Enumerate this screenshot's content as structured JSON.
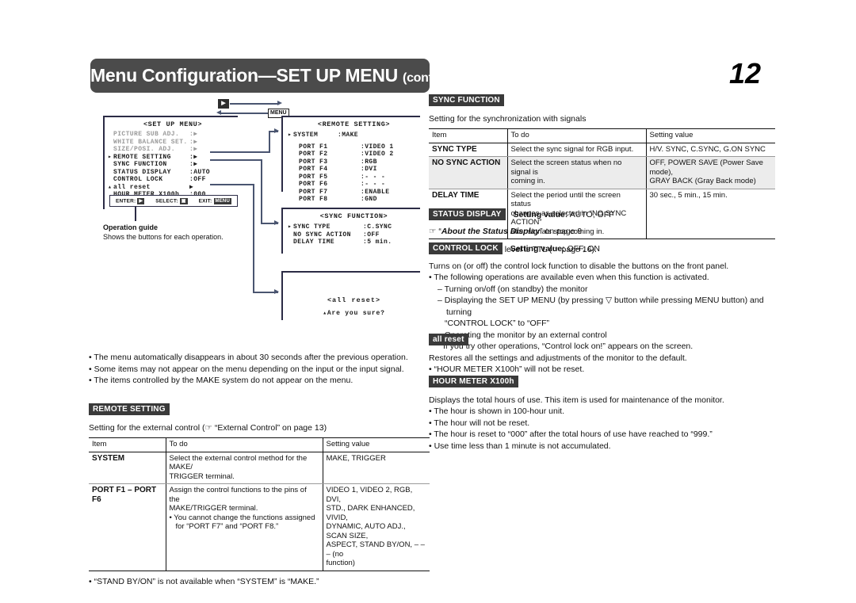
{
  "header": {
    "title_main": "Menu Configuration—SET UP MENU",
    "title_cont": "(cont.)",
    "page_number": "12"
  },
  "diagram": {
    "buttons": {
      "enter_chip": "▶",
      "menu_chip": "MENU"
    },
    "setup_menu": {
      "title": "<SET UP MENU>",
      "rows": [
        {
          "cursor": "",
          "key": "PICTURE SUB ADJ.",
          "value": ":▶",
          "dim": true
        },
        {
          "cursor": "",
          "key": "WHITE BALANCE SET.",
          "value": ":▶",
          "dim": true
        },
        {
          "cursor": "",
          "key": "SIZE/POSI. ADJ.",
          "value": ":▶",
          "dim": true
        },
        {
          "cursor": "▸",
          "key": "REMOTE SETTING",
          "value": ":▶",
          "dim": false
        },
        {
          "cursor": "",
          "key": "SYNC FUNCTION",
          "value": ":▶",
          "dim": false
        },
        {
          "cursor": "",
          "key": "STATUS DISPLAY",
          "value": ":AUTO",
          "dim": false
        },
        {
          "cursor": "",
          "key": "CONTROL LOCK",
          "value": ":OFF",
          "dim": false
        },
        {
          "cursor": "▴",
          "key": "all reset",
          "value": "▶",
          "dim": false
        },
        {
          "cursor": "",
          "key": "HOUR METER X100h",
          "value": ":000",
          "dim": false
        }
      ],
      "guide": {
        "enter_label": "ENTER:",
        "enter_key": "▶",
        "select_label": "SELECT:",
        "select_key": "▣",
        "exit_label": "EXIT:",
        "exit_key": "MENU"
      }
    },
    "operation_guide": {
      "title": "Operation guide",
      "text": "Shows the buttons for each operation."
    },
    "remote_setting": {
      "title": "<REMOTE SETTING>",
      "system_row": {
        "cursor": "▸",
        "key": "SYSTEM",
        "value": ":MAKE"
      },
      "ports": [
        {
          "key": "PORT F1",
          "value": ":VIDEO 1"
        },
        {
          "key": "PORT F2",
          "value": ":VIDEO 2"
        },
        {
          "key": "PORT F3",
          "value": ":RGB"
        },
        {
          "key": "PORT F4",
          "value": ":DVI"
        },
        {
          "key": "PORT F5",
          "value": ":- - -"
        },
        {
          "key": "PORT F6",
          "value": ":- - -"
        },
        {
          "key": "PORT F7",
          "value": ":ENABLE"
        },
        {
          "key": "PORT F8",
          "value": ":GND"
        }
      ]
    },
    "sync_function": {
      "title": "<SYNC FUNCTION>",
      "rows": [
        {
          "cursor": "▸",
          "key": "SYNC TYPE",
          "value": ":C.SYNC"
        },
        {
          "cursor": "",
          "key": "NO SYNC ACTION",
          "value": ":OFF"
        },
        {
          "cursor": "",
          "key": "DELAY TIME",
          "value": ":5 min."
        }
      ]
    },
    "all_reset": {
      "title": "<all reset>",
      "question": "▴Are you sure?"
    }
  },
  "left_column": {
    "notes": [
      "The menu automatically disappears in about 30 seconds after the previous operation.",
      "Some items may not appear on the menu depending on the input or the input signal.",
      "The items controlled by the MAKE system do not appear on the menu."
    ],
    "remote_setting_section": {
      "tag": "REMOTE SETTING",
      "intro": "Setting for the external control (☞ “External Control” on page 13)",
      "table": {
        "headers": [
          "Item",
          "To do",
          "Setting value"
        ],
        "rows": [
          {
            "item": "SYSTEM",
            "todo_lines": [
              "Select the external control method for the MAKE/",
              "TRIGGER terminal."
            ],
            "todo_bullets": [],
            "value_lines": [
              "MAKE, TRIGGER"
            ]
          },
          {
            "item": "PORT F1 – PORT F6",
            "todo_lines": [
              "Assign the control functions to the pins of the",
              "MAKE/TRIGGER terminal."
            ],
            "todo_bullets": [
              "You cannot change the functions assigned for “PORT F7” and “PORT F8.”"
            ],
            "value_lines": [
              "VIDEO 1, VIDEO 2, RGB, DVI,",
              "STD., DARK ENHANCED, VIVID,",
              "DYNAMIC, AUTO ADJ., SCAN SIZE,",
              "ASPECT, STAND BY/ON, – – – (no",
              "function)"
            ]
          }
        ]
      },
      "footnote": "“STAND BY/ON” is not available when “SYSTEM” is “MAKE.”"
    }
  },
  "right_column": {
    "sync_function_section": {
      "tag": "SYNC FUNCTION",
      "intro": "Setting for the synchronization with signals",
      "table": {
        "headers": [
          "Item",
          "To do",
          "Setting value"
        ],
        "rows": [
          {
            "item": "SYNC TYPE",
            "todo_lines": [
              "Select the sync signal for RGB input."
            ],
            "value_lines": [
              "H/V. SYNC, C.SYNC, G.ON SYNC"
            ]
          },
          {
            "item": "NO SYNC ACTION",
            "todo_lines": [
              "Select the screen status when no signal is",
              "coming in."
            ],
            "value_lines": [
              "OFF, POWER SAVE (Power Save mode),",
              "GRAY BACK (Gray Back mode)"
            ]
          },
          {
            "item": "DELAY TIME",
            "todo_lines": [
              "Select the period until the screen status",
              "changes as selected in “NO SYNC ACTION”",
              "after signals stop coming in."
            ],
            "value_lines": [
              "30 sec., 5 min., 15 min."
            ]
          }
        ]
      },
      "footnote": "The C.SYNC input level is TTL (☞ page 16)."
    },
    "status_display_section": {
      "tag": "STATUS DISPLAY",
      "setting_label": "Setting value:",
      "setting_value": "AUTO, OFF",
      "ref_prefix": "☞ “",
      "ref_italic": "About the Status Display",
      "ref_suffix": "” on page 9"
    },
    "control_lock_section": {
      "tag": "CONTROL LOCK",
      "setting_label": "Setting value:",
      "setting_value": "OFF, ON",
      "body": "Turns on (or off) the control lock function to disable the buttons on the front panel.",
      "bullet": "The following operations are available even when this function is activated.",
      "dashes": [
        "Turning on/off (on standby) the monitor",
        "Displaying the SET UP MENU (by pressing ▽ button while pressing MENU button) and turning"
      ],
      "dash_cont": "“CONTROL LOCK” to “OFF”",
      "dash_last": "Operating the monitor by an external control",
      "closing": "If you try other operations, “Control lock on!” appears on the screen."
    },
    "all_reset_section": {
      "tag": "all reset",
      "body": "Restores all the settings and adjustments of the monitor to the default.",
      "bullets": [
        "“HOUR METER X100h” will not be reset."
      ]
    },
    "hour_meter_section": {
      "tag": "HOUR METER X100h",
      "body": "Displays the total hours of use. This item is used for maintenance of the monitor.",
      "bullets": [
        "The hour is shown in 100-hour unit.",
        "The hour will not be reset.",
        "The hour is reset to “000” after the total hours of use have reached to “999.”",
        "Use time less than 1 minute is not accumulated."
      ]
    }
  },
  "colors": {
    "header_bar": "#4b4b4b",
    "tag_badge": "#3a3a3a",
    "connector": "#4a5570",
    "osd_border": "#2b2b45"
  }
}
